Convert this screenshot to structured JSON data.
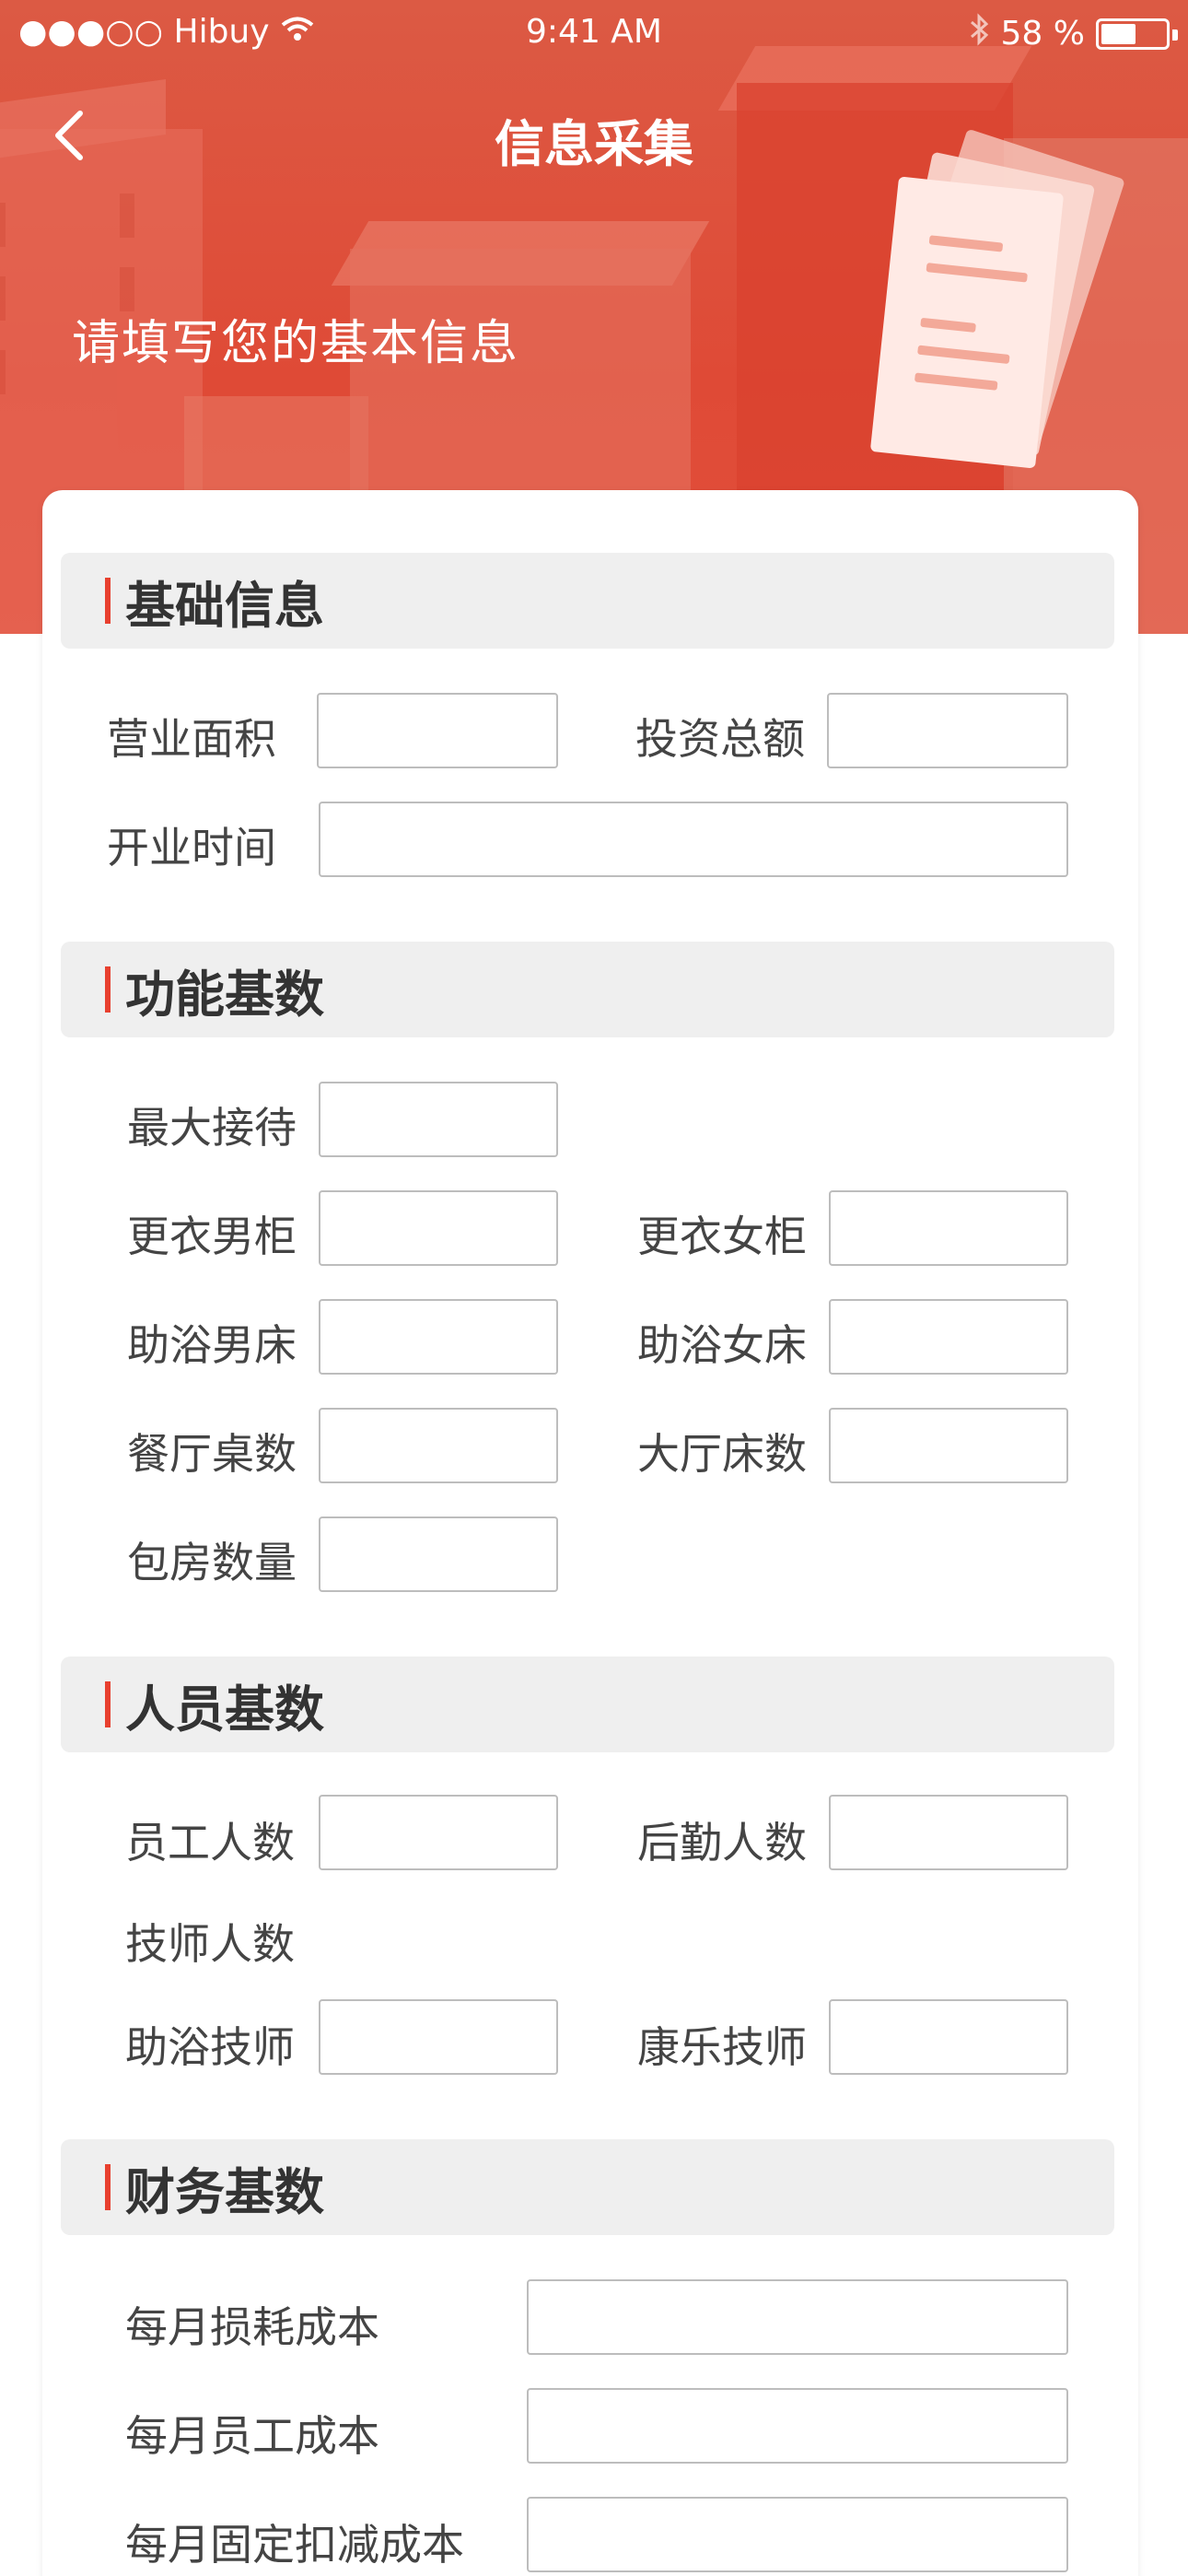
{
  "status_bar": {
    "carrier": "●●●○○ Hibuy",
    "time": "9:41 AM",
    "battery_text": "58 %",
    "battery_level": 0.58
  },
  "nav": {
    "title": "信息采集"
  },
  "hero": {
    "subtitle": "请填写您的基本信息"
  },
  "sections": {
    "basic": {
      "title": "基础信息",
      "area_label": "营业面积",
      "area_value": "",
      "investment_label": "投资总额",
      "investment_value": "",
      "open_time_label": "开业时间",
      "open_time_value": ""
    },
    "function": {
      "title": "功能基数",
      "max_reception_label": "最大接待",
      "male_locker_label": "更衣男柜",
      "female_locker_label": "更衣女柜",
      "male_bath_bed_label": "助浴男床",
      "female_bath_bed_label": "助浴女床",
      "dining_tables_label": "餐厅桌数",
      "hall_beds_label": "大厅床数",
      "private_rooms_label": "包房数量"
    },
    "staff": {
      "title": "人员基数",
      "employees_label": "员工人数",
      "logistics_label": "后勤人数",
      "technicians_label": "技师人数",
      "bath_technicians_label": "助浴技师",
      "recreation_technicians_label": "康乐技师"
    },
    "finance": {
      "title": "财务基数",
      "monthly_loss_label": "每月损耗成本",
      "monthly_staff_cost_label": "每月员工成本",
      "monthly_fixed_deduction_label": "每月固定扣减成本"
    }
  }
}
